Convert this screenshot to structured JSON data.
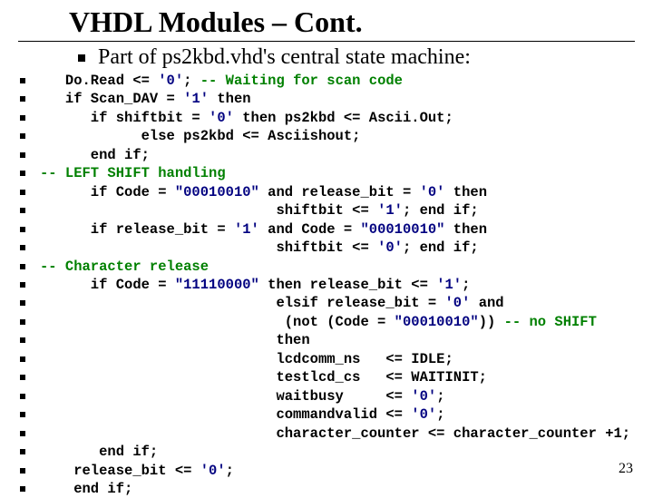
{
  "title": "VHDL Modules – Cont.",
  "subtitle": "Part of ps2kbd.vhd's central state machine:",
  "pagenum": "23",
  "code": [
    [
      {
        "t": "   Do.Read <= "
      },
      {
        "t": "'0'",
        "c": "navy"
      },
      {
        "t": "; "
      },
      {
        "t": "-- Waiting for scan code",
        "c": "green"
      }
    ],
    [
      {
        "t": "   if Scan_DAV = "
      },
      {
        "t": "'1'",
        "c": "navy"
      },
      {
        "t": " then"
      }
    ],
    [
      {
        "t": "      if shiftbit = "
      },
      {
        "t": "'0'",
        "c": "navy"
      },
      {
        "t": " then ps2kbd <= Ascii.Out;"
      }
    ],
    [
      {
        "t": "            else ps2kbd <= Asciishout;"
      }
    ],
    [
      {
        "t": "      end if;"
      }
    ],
    [
      {
        "t": "-- LEFT SHIFT handling",
        "c": "green"
      }
    ],
    [
      {
        "t": "      if Code = "
      },
      {
        "t": "\"00010010\"",
        "c": "navy"
      },
      {
        "t": " and release_bit = "
      },
      {
        "t": "'0'",
        "c": "navy"
      },
      {
        "t": " then"
      }
    ],
    [
      {
        "t": "                            shiftbit <= "
      },
      {
        "t": "'1'",
        "c": "navy"
      },
      {
        "t": "; end if;"
      }
    ],
    [
      {
        "t": "      if release_bit = "
      },
      {
        "t": "'1'",
        "c": "navy"
      },
      {
        "t": " and Code = "
      },
      {
        "t": "\"00010010\"",
        "c": "navy"
      },
      {
        "t": " then"
      }
    ],
    [
      {
        "t": "                            shiftbit <= "
      },
      {
        "t": "'0'",
        "c": "navy"
      },
      {
        "t": "; end if;"
      }
    ],
    [
      {
        "t": "-- Character release",
        "c": "green"
      }
    ],
    [
      {
        "t": "      if Code = "
      },
      {
        "t": "\"11110000\"",
        "c": "navy"
      },
      {
        "t": " then release_bit <= "
      },
      {
        "t": "'1'",
        "c": "navy"
      },
      {
        "t": ";"
      }
    ],
    [
      {
        "t": "                            elsif release_bit = "
      },
      {
        "t": "'0'",
        "c": "navy"
      },
      {
        "t": " and"
      }
    ],
    [
      {
        "t": "                             (not (Code = "
      },
      {
        "t": "\"00010010\"",
        "c": "navy"
      },
      {
        "t": ")) "
      },
      {
        "t": "-- no SHIFT",
        "c": "green"
      }
    ],
    [
      {
        "t": "                            then"
      }
    ],
    [
      {
        "t": "                            lcdcomm_ns   <= IDLE;"
      }
    ],
    [
      {
        "t": "                            testlcd_cs   <= WAITINIT;"
      }
    ],
    [
      {
        "t": "                            waitbusy     <= "
      },
      {
        "t": "'0'",
        "c": "navy"
      },
      {
        "t": ";"
      }
    ],
    [
      {
        "t": "                            commandvalid <= "
      },
      {
        "t": "'0'",
        "c": "navy"
      },
      {
        "t": ";"
      }
    ],
    [
      {
        "t": "                            character_counter <= character_counter +1;"
      }
    ],
    [
      {
        "t": "       end if;"
      }
    ],
    [
      {
        "t": "    release_bit <= "
      },
      {
        "t": "'0'",
        "c": "navy"
      },
      {
        "t": ";"
      }
    ],
    [
      {
        "t": "    end if;"
      }
    ]
  ]
}
